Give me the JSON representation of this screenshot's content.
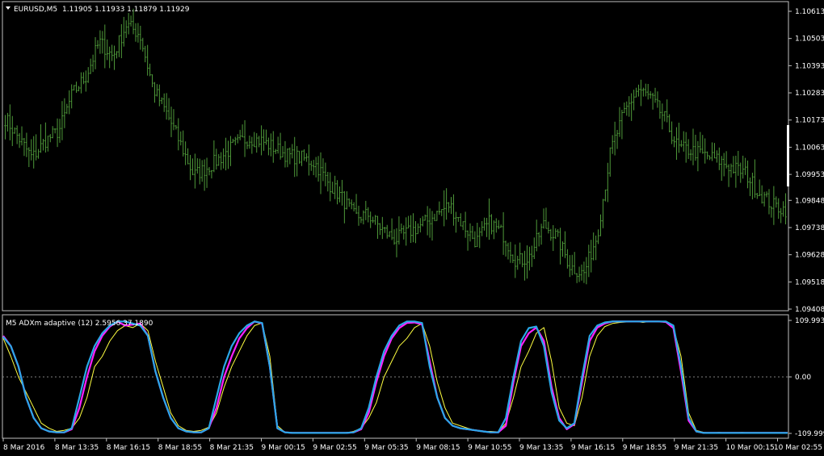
{
  "window": {
    "symbol_label": "EURUSD,M5",
    "ohlc_label": "1.11905 1.11933 1.11879 1.11929",
    "indicator_label": "M5 ADXm adaptive (12) 2.5956 37.1890"
  },
  "colors": {
    "background": "#000000",
    "frame": "#c0c0c0",
    "candles": "#4f9a3a",
    "indicator_a": "#2aa8e8",
    "indicator_b": "#ff20ff",
    "indicator_c": "#ffff40",
    "zero_line": "#808080",
    "label_text": "#ffffff"
  },
  "chart_data": [
    {
      "type": "line",
      "title": "EURUSD,M5",
      "style": "bar (OHLC) chart",
      "price_ticks": [
        "1.10613",
        "1.10503",
        "1.10393",
        "1.10283",
        "1.10173",
        "1.10063",
        "1.09953",
        "1.09848",
        "1.09738",
        "1.09628",
        "1.09518",
        "1.09408"
      ],
      "ylim": [
        1.09408,
        1.10613
      ],
      "grid": false,
      "x": [
        "8 Mar 2016",
        "8 Mar 13:35",
        "8 Mar 16:15",
        "8 Mar 18:55",
        "8 Mar 21:35",
        "9 Mar 00:15",
        "9 Mar 02:55",
        "9 Mar 05:35",
        "9 Mar 08:15",
        "9 Mar 10:55",
        "9 Mar 13:35",
        "9 Mar 16:15",
        "9 Mar 18:55",
        "9 Mar 21:35",
        "10 Mar 00:15",
        "10 Mar 02:55"
      ],
      "series": [
        {
          "values": [
            1.1018,
            1.101,
            1.1002,
            1.1009,
            1.1013,
            1.1028,
            1.1035,
            1.1049,
            1.1043,
            1.1056,
            1.1052,
            1.103,
            1.102,
            1.1008,
            1.0995,
            1.0998,
            1.1002,
            1.1007,
            1.101,
            1.1009,
            1.1006,
            1.1003,
            1.1002,
            1.1,
            1.0992,
            1.0986,
            1.0978,
            1.0979,
            1.0973,
            1.0969,
            1.0972,
            1.0975,
            1.0979,
            1.0983,
            1.0975,
            1.0968,
            1.0976,
            1.0971,
            1.096,
            1.0962,
            1.0975,
            1.097,
            1.0958,
            1.0955,
            1.0971,
            1.1005,
            1.102,
            1.103,
            1.1026,
            1.1018,
            1.1006,
            1.1005,
            1.1003,
            1.1001,
            1.0998,
            1.0996,
            1.0988,
            1.0983,
            1.0981
          ]
        }
      ]
    },
    {
      "type": "line",
      "title": "M5 ADXm adaptive (12) 2.5956 37.1890",
      "y_ticks": [
        "109.9933",
        "0.00",
        "-109.9997"
      ],
      "ylim": [
        -109.9997,
        109.9933
      ],
      "zero_line": 0,
      "grid": false,
      "series": [
        {
          "values": [
            78,
            60,
            20,
            -40,
            -80,
            -100,
            -106,
            -108,
            -108,
            -100,
            -40,
            20,
            60,
            85,
            100,
            108,
            108,
            104,
            100,
            80,
            10,
            -40,
            -80,
            -100,
            -106,
            -108,
            -108,
            -100,
            -40,
            20,
            60,
            85,
            100,
            108,
            105,
            20,
            -100,
            -108,
            -109,
            -109,
            -109,
            -109,
            -109,
            -109,
            -109,
            -109,
            -108,
            -100,
            -60,
            0,
            50,
            80,
            100,
            108,
            108,
            105,
            20,
            -40,
            -80,
            -95,
            -100,
            -102,
            -104,
            -106,
            -108,
            -108,
            -80,
            0,
            70,
            95,
            98,
            60,
            -30,
            -85,
            -100,
            -90,
            0,
            80,
            100,
            106,
            108,
            108,
            108,
            108,
            108,
            108,
            108,
            108,
            100,
            20,
            -80,
            -106,
            -109,
            -109,
            -109,
            -109,
            -109,
            -109,
            -109,
            -109,
            -109,
            -109,
            -109,
            -109
          ]
        },
        {
          "values": [
            80,
            60,
            20,
            -40,
            -80,
            -100,
            -106,
            -108,
            -108,
            -102,
            -60,
            0,
            50,
            80,
            98,
            108,
            100,
            102,
            104,
            80,
            10,
            -40,
            -80,
            -100,
            -106,
            -108,
            -108,
            -100,
            -60,
            0,
            40,
            75,
            95,
            108,
            104,
            20,
            -100,
            -108,
            -109,
            -109,
            -109,
            -109,
            -109,
            -109,
            -109,
            -109,
            -108,
            -102,
            -70,
            -10,
            40,
            75,
            95,
            105,
            106,
            102,
            30,
            -40,
            -80,
            -95,
            -100,
            -102,
            -104,
            -106,
            -108,
            -108,
            -95,
            -10,
            60,
            85,
            96,
            70,
            -20,
            -80,
            -102,
            -92,
            -10,
            70,
            96,
            104,
            108,
            108,
            108,
            108,
            108,
            108,
            108,
            107,
            95,
            10,
            -85,
            -106,
            -109,
            -109,
            -109,
            -109,
            -109,
            -109,
            -109,
            -109,
            -109,
            -109,
            -109,
            -109
          ]
        },
        {
          "values": [
            75,
            40,
            0,
            -30,
            -60,
            -90,
            -100,
            -106,
            -104,
            -100,
            -80,
            -40,
            20,
            40,
            70,
            90,
            100,
            96,
            104,
            90,
            30,
            -20,
            -70,
            -95,
            -104,
            -106,
            -104,
            -98,
            -70,
            -20,
            20,
            50,
            80,
            100,
            105,
            40,
            -95,
            -108,
            -109,
            -109,
            -109,
            -109,
            -109,
            -109,
            -109,
            -109,
            -106,
            -100,
            -80,
            -50,
            0,
            30,
            60,
            75,
            96,
            104,
            60,
            -10,
            -60,
            -90,
            -95,
            -100,
            -104,
            -106,
            -106,
            -107,
            -90,
            -40,
            20,
            50,
            85,
            96,
            30,
            -60,
            -90,
            -95,
            -40,
            40,
            80,
            98,
            104,
            106,
            107,
            108,
            106,
            108,
            108,
            106,
            96,
            40,
            -70,
            -104,
            -108,
            -109,
            -108,
            -109,
            -109,
            -108,
            -109,
            -109,
            -109,
            -109,
            -109,
            -109
          ]
        }
      ]
    }
  ]
}
